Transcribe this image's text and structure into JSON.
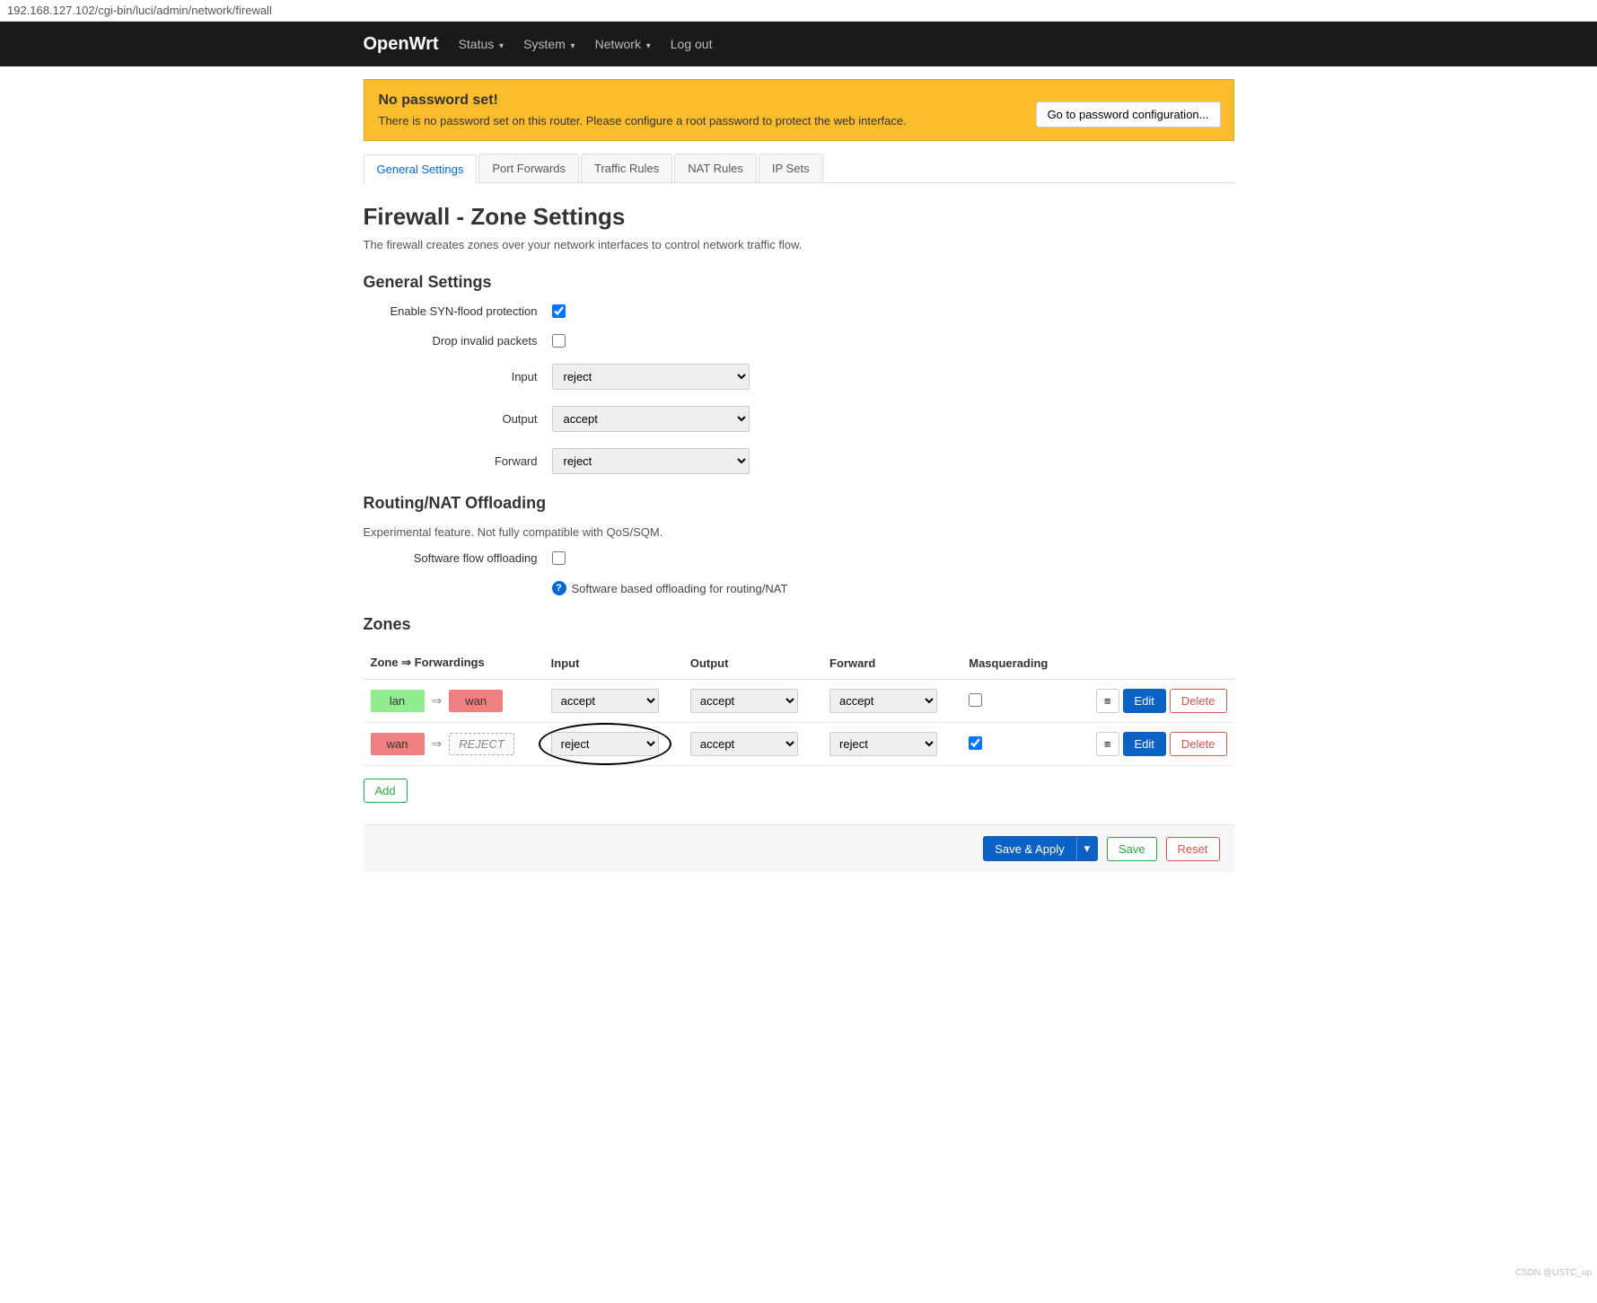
{
  "url": "192.168.127.102/cgi-bin/luci/admin/network/firewall",
  "brand": "OpenWrt",
  "nav": {
    "status": "Status",
    "system": "System",
    "network": "Network",
    "logout": "Log out"
  },
  "alert": {
    "title": "No password set!",
    "body": "There is no password set on this router. Please configure a root password to protect the web interface.",
    "button": "Go to password configuration..."
  },
  "tabs": {
    "general": "General Settings",
    "port_forwards": "Port Forwards",
    "traffic_rules": "Traffic Rules",
    "nat_rules": "NAT Rules",
    "ip_sets": "IP Sets"
  },
  "page": {
    "title": "Firewall - Zone Settings",
    "desc": "The firewall creates zones over your network interfaces to control network traffic flow."
  },
  "general": {
    "heading": "General Settings",
    "syn_flood_label": "Enable SYN-flood protection",
    "drop_invalid_label": "Drop invalid packets",
    "input_label": "Input",
    "input_value": "reject",
    "output_label": "Output",
    "output_value": "accept",
    "forward_label": "Forward",
    "forward_value": "reject"
  },
  "offloading": {
    "heading": "Routing/NAT Offloading",
    "desc": "Experimental feature. Not fully compatible with QoS/SQM.",
    "sw_offload_label": "Software flow offloading",
    "help_text": "Software based offloading for routing/NAT"
  },
  "zones": {
    "heading": "Zones",
    "col_zone": "Zone ⇒ Forwardings",
    "col_input": "Input",
    "col_output": "Output",
    "col_forward": "Forward",
    "col_masq": "Masquerading",
    "rows": [
      {
        "src": "lan",
        "src_class": "zone-lan",
        "dst": "wan",
        "dst_class": "zone-wan",
        "dst_reject": false,
        "input": "accept",
        "output": "accept",
        "forward": "accept",
        "masq": false,
        "circled": false
      },
      {
        "src": "wan",
        "src_class": "zone-wan",
        "dst": "REJECT",
        "dst_class": "zone-reject",
        "dst_reject": true,
        "input": "reject",
        "output": "accept",
        "forward": "reject",
        "masq": true,
        "circled": true
      }
    ],
    "btn_drag": "≡",
    "btn_edit": "Edit",
    "btn_delete": "Delete",
    "btn_add": "Add"
  },
  "footer": {
    "save_apply": "Save & Apply",
    "save": "Save",
    "reset": "Reset"
  },
  "watermark": "CSDN @USTC_up"
}
